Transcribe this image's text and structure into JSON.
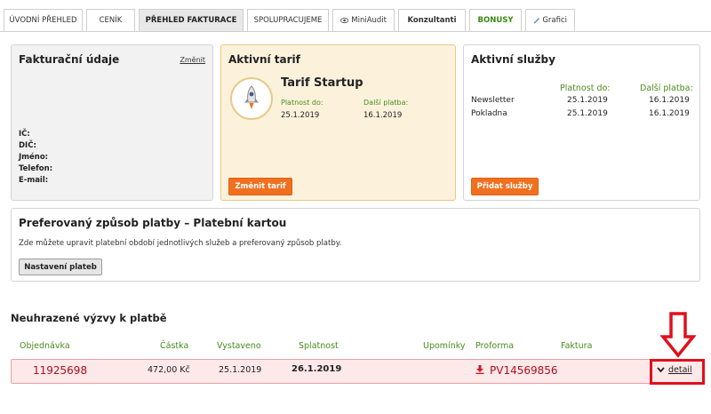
{
  "tabs": [
    {
      "label": "ÚVODNÍ PŘEHLED"
    },
    {
      "label": "CENÍK"
    },
    {
      "label": "PŘEHLED FAKTURACE"
    },
    {
      "label": "SPOLUPRACUJEME"
    },
    {
      "label": "MiniAudit"
    },
    {
      "label": "Konzultanti"
    },
    {
      "label": "BONUSY"
    },
    {
      "label": "Grafici"
    }
  ],
  "billing": {
    "title": "Fakturační údaje",
    "change_link": "Změnit",
    "fields": [
      "IČ:",
      "DIČ:",
      "Jméno:",
      "Telefon:",
      "E-mail:"
    ]
  },
  "tariff": {
    "title": "Aktivní tarif",
    "name": "Tarif Startup",
    "valid_label": "Platnost do:",
    "valid_value": "25.1.2019",
    "next_label": "Další platba:",
    "next_value": "16.1.2019",
    "button": "Změnit tarif"
  },
  "services": {
    "title": "Aktivní služby",
    "col_valid": "Platnost do:",
    "col_next": "Další platba:",
    "rows": [
      {
        "name": "Newsletter",
        "valid": "25.1.2019",
        "next": "16.1.2019"
      },
      {
        "name": "Pokladna",
        "valid": "25.1.2019",
        "next": "16.1.2019"
      }
    ],
    "button": "Přidat služby"
  },
  "payment": {
    "title": "Preferovaný způsob platby – Platební kartou",
    "description": "Zde můžete upravit platební období jednotlivých služeb a preferovaný způsob platby.",
    "button": "Nastavení plateb"
  },
  "unpaid": {
    "title": "Neuhrazené výzvy k platbě",
    "columns": {
      "order": "Objednávka",
      "amount": "Částka",
      "issued": "Vystaveno",
      "due": "Splatnost",
      "reminders": "Upomínky",
      "proforma": "Proforma",
      "invoice": "Faktura"
    },
    "row": {
      "order": "11925698",
      "amount": "472,00 Kč",
      "issued": "25.1.2019",
      "due": "26.1.2019",
      "proforma": "PV14569856",
      "detail": "detail"
    }
  },
  "colors": {
    "accent_green": "#4a8c1c",
    "orange_button": "#f07020",
    "highlight_red": "#e0101c",
    "row_bg": "#fde8ea"
  }
}
